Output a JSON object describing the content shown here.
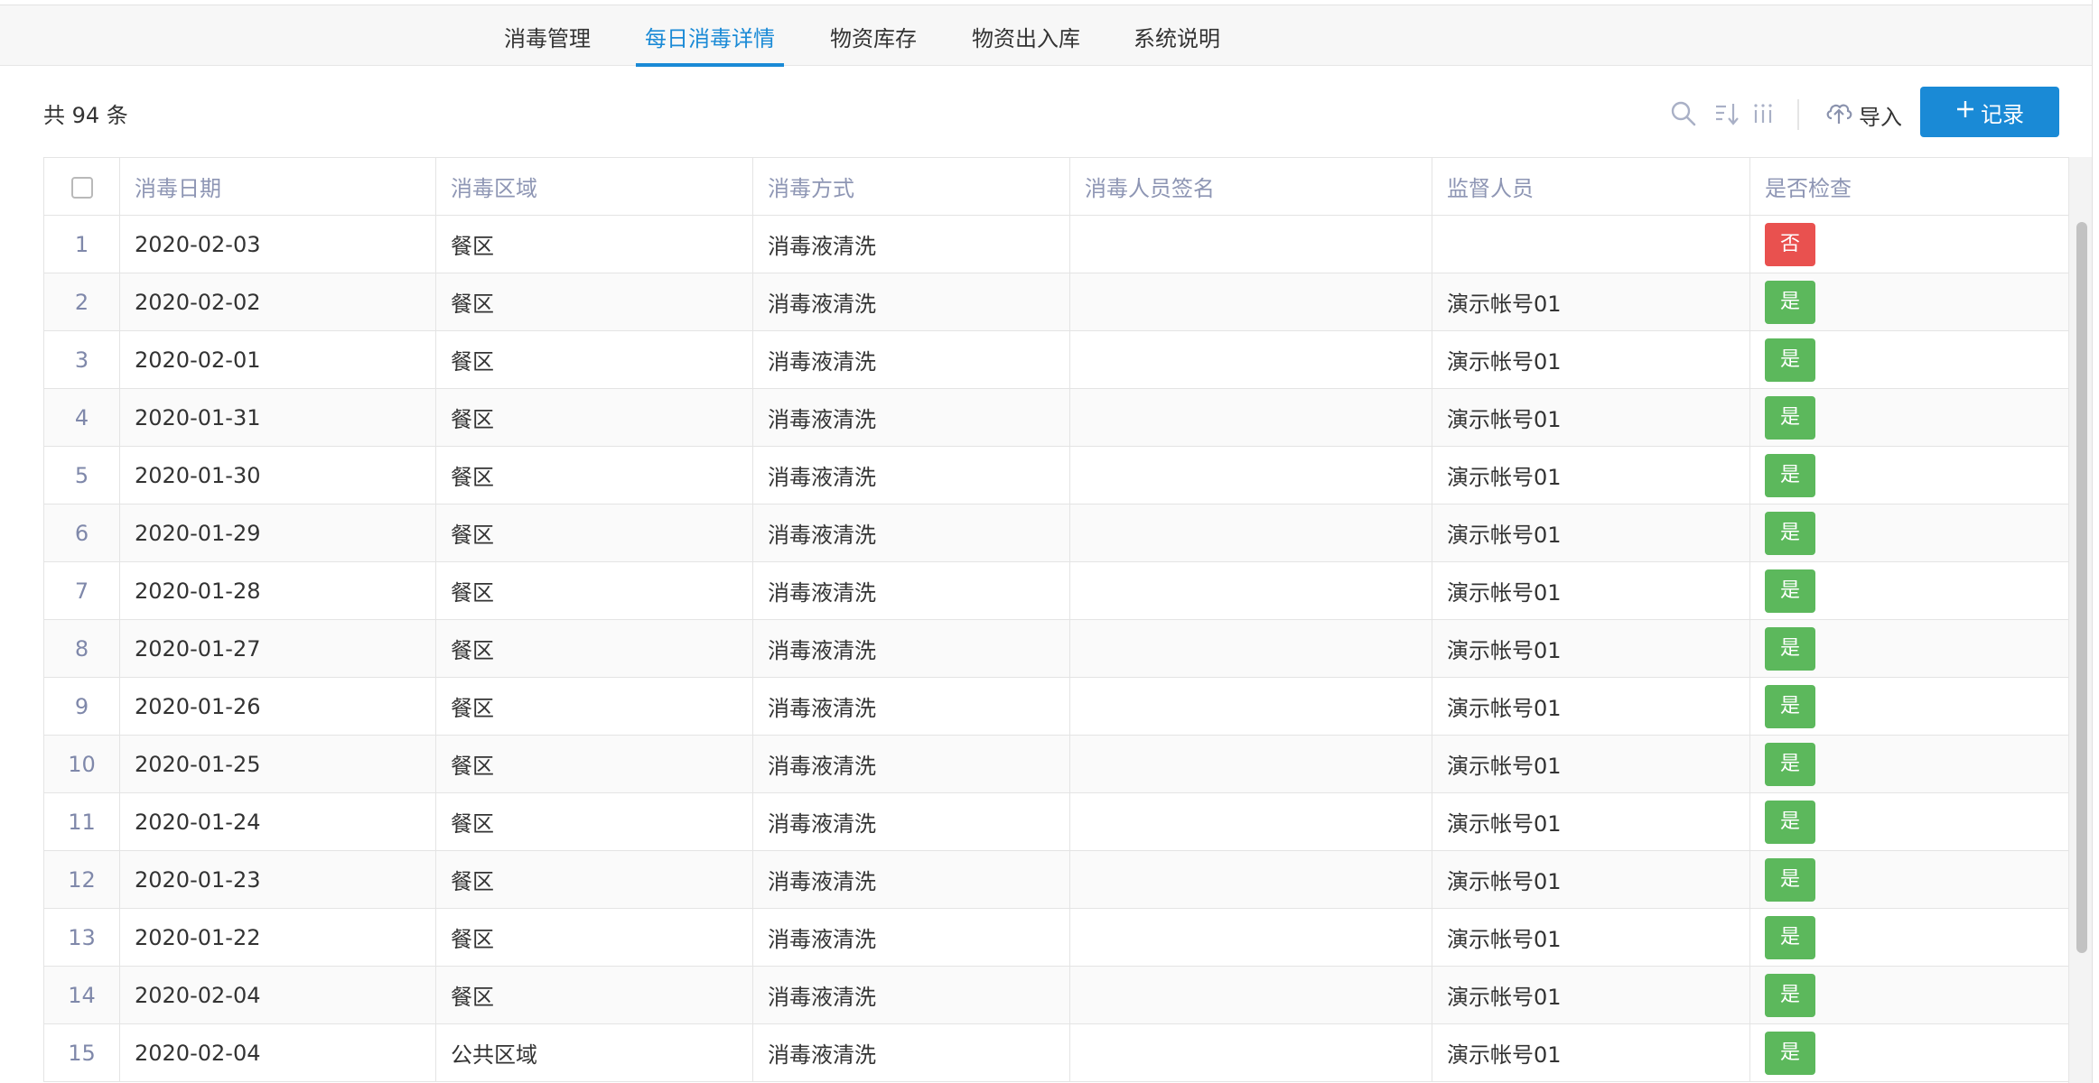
{
  "tabs": [
    {
      "label": "消毒管理",
      "active": false
    },
    {
      "label": "每日消毒详情",
      "active": true
    },
    {
      "label": "物资库存",
      "active": false
    },
    {
      "label": "物资出入库",
      "active": false
    },
    {
      "label": "系统说明",
      "active": false
    }
  ],
  "toolbar": {
    "count_label": "共 94 条",
    "icons": [
      "search-icon",
      "sort-icon",
      "columns-icon"
    ],
    "import_label": "导入",
    "add_label": "记录"
  },
  "colors": {
    "accent": "#1a8ad6",
    "badge_yes": "#5cb85c",
    "badge_no": "#e9514f",
    "header_text": "#8e96b4"
  },
  "table": {
    "columns": [
      "消毒日期",
      "消毒区域",
      "消毒方式",
      "消毒人员签名",
      "监督人员",
      "是否检查"
    ],
    "rows": [
      {
        "index": "1",
        "date": "2020-02-03",
        "area": "餐区",
        "method": "消毒液清洗",
        "signer": "",
        "supervisor": "",
        "checked": "否"
      },
      {
        "index": "2",
        "date": "2020-02-02",
        "area": "餐区",
        "method": "消毒液清洗",
        "signer": "",
        "supervisor": "演示帐号01",
        "checked": "是"
      },
      {
        "index": "3",
        "date": "2020-02-01",
        "area": "餐区",
        "method": "消毒液清洗",
        "signer": "",
        "supervisor": "演示帐号01",
        "checked": "是"
      },
      {
        "index": "4",
        "date": "2020-01-31",
        "area": "餐区",
        "method": "消毒液清洗",
        "signer": "",
        "supervisor": "演示帐号01",
        "checked": "是"
      },
      {
        "index": "5",
        "date": "2020-01-30",
        "area": "餐区",
        "method": "消毒液清洗",
        "signer": "",
        "supervisor": "演示帐号01",
        "checked": "是"
      },
      {
        "index": "6",
        "date": "2020-01-29",
        "area": "餐区",
        "method": "消毒液清洗",
        "signer": "",
        "supervisor": "演示帐号01",
        "checked": "是"
      },
      {
        "index": "7",
        "date": "2020-01-28",
        "area": "餐区",
        "method": "消毒液清洗",
        "signer": "",
        "supervisor": "演示帐号01",
        "checked": "是"
      },
      {
        "index": "8",
        "date": "2020-01-27",
        "area": "餐区",
        "method": "消毒液清洗",
        "signer": "",
        "supervisor": "演示帐号01",
        "checked": "是"
      },
      {
        "index": "9",
        "date": "2020-01-26",
        "area": "餐区",
        "method": "消毒液清洗",
        "signer": "",
        "supervisor": "演示帐号01",
        "checked": "是"
      },
      {
        "index": "10",
        "date": "2020-01-25",
        "area": "餐区",
        "method": "消毒液清洗",
        "signer": "",
        "supervisor": "演示帐号01",
        "checked": "是"
      },
      {
        "index": "11",
        "date": "2020-01-24",
        "area": "餐区",
        "method": "消毒液清洗",
        "signer": "",
        "supervisor": "演示帐号01",
        "checked": "是"
      },
      {
        "index": "12",
        "date": "2020-01-23",
        "area": "餐区",
        "method": "消毒液清洗",
        "signer": "",
        "supervisor": "演示帐号01",
        "checked": "是"
      },
      {
        "index": "13",
        "date": "2020-01-22",
        "area": "餐区",
        "method": "消毒液清洗",
        "signer": "",
        "supervisor": "演示帐号01",
        "checked": "是"
      },
      {
        "index": "14",
        "date": "2020-02-04",
        "area": "餐区",
        "method": "消毒液清洗",
        "signer": "",
        "supervisor": "演示帐号01",
        "checked": "是"
      },
      {
        "index": "15",
        "date": "2020-02-04",
        "area": "公共区域",
        "method": "消毒液清洗",
        "signer": "",
        "supervisor": "演示帐号01",
        "checked": "是"
      }
    ]
  }
}
